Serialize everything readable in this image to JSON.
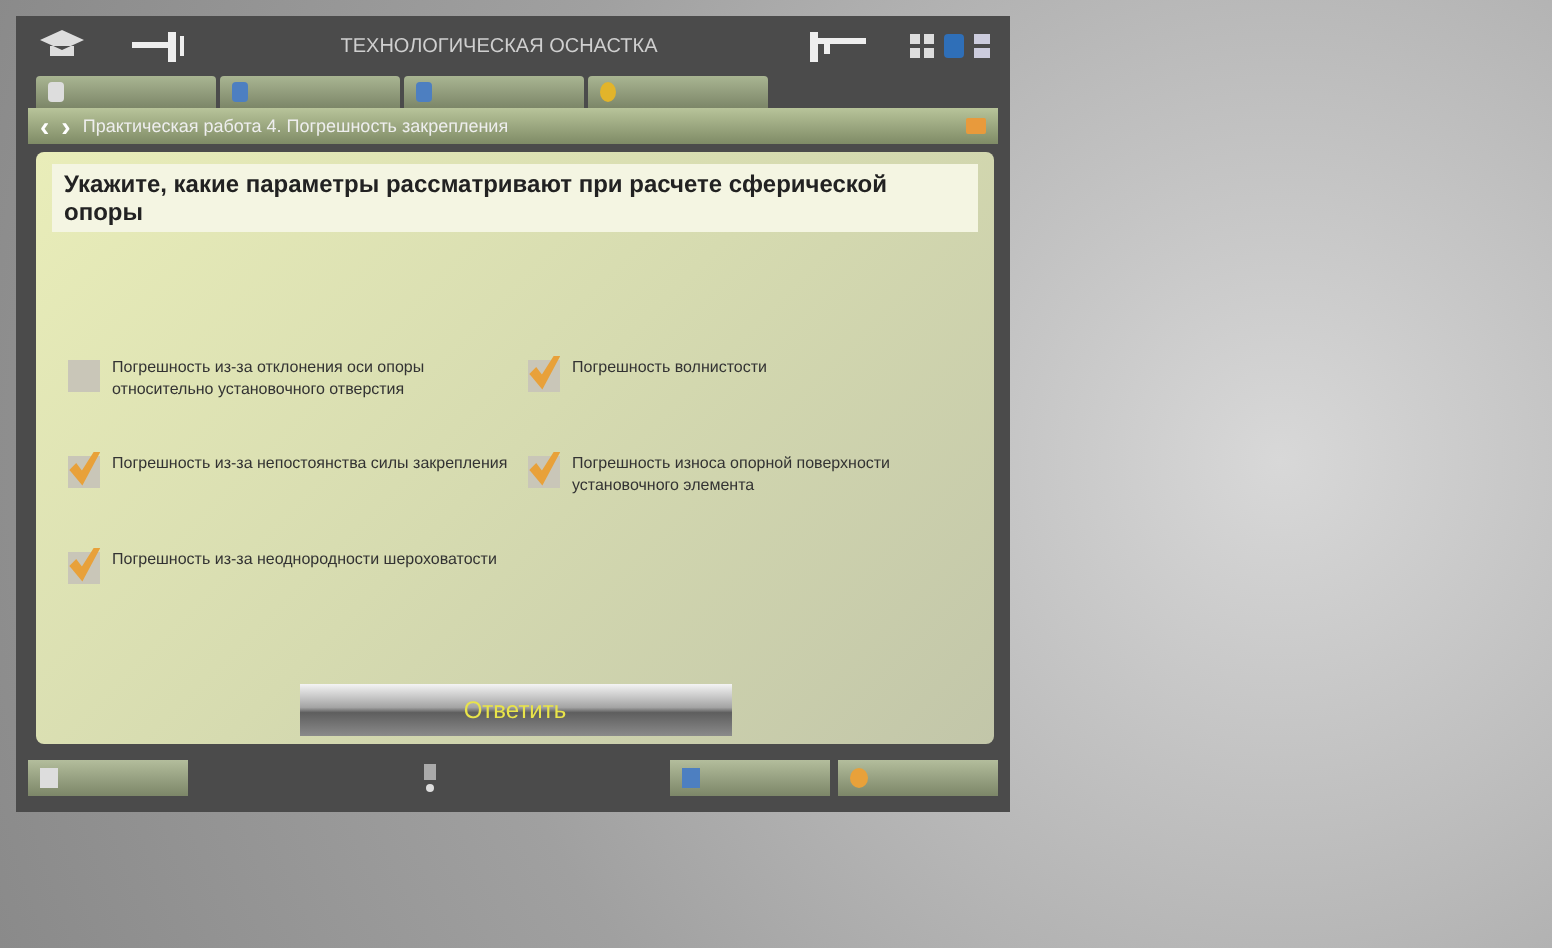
{
  "header": {
    "title": "ТЕХНОЛОГИЧЕСКАЯ ОСНАСТКА"
  },
  "tabs": [
    {
      "selected": false
    },
    {
      "selected": false
    },
    {
      "selected": false
    },
    {
      "selected": false
    }
  ],
  "breadcrumb": {
    "back": "‹",
    "forward": "›",
    "title": "Практическая работа 4. Погрешность закрепления"
  },
  "question": "Укажите, какие параметры рассматривают при расчете сферической опоры",
  "options": [
    {
      "label": "Погрешность из-за отклонения оси опоры относительно установочного отверстия",
      "checked": false
    },
    {
      "label": "Погрешность волнистости",
      "checked": true
    },
    {
      "label": "Погрешность из-за непостоянства силы закрепления",
      "checked": true
    },
    {
      "label": "Погрешность износа опорной поверхности установочного элемента",
      "checked": true
    },
    {
      "label": "Погрешность из-за неоднородности шероховатости",
      "checked": true
    }
  ],
  "answer_button": "Ответить"
}
